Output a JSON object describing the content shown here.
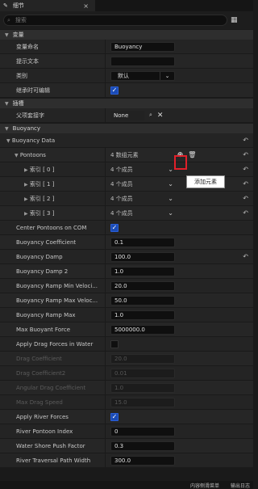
{
  "tab": {
    "title": "细节",
    "close": "×"
  },
  "search": {
    "placeholder": "搜索"
  },
  "sections": {
    "variable": "变量",
    "slot": "插槽",
    "buoyancy": "Buoyancy"
  },
  "variable": {
    "name_label": "变量命名",
    "name_value": "Buoyancy",
    "tooltip_label": "提示文本",
    "tooltip_value": "",
    "category_label": "类别",
    "category_value": "默认",
    "editable_label": "继承时可编辑"
  },
  "slot": {
    "parent_label": "父项套接字",
    "parent_value": "None"
  },
  "buoyancy": {
    "data_label": "Buoyancy Data",
    "pontoons_label": "Pontoons",
    "pontoons_value": "4 数组元素",
    "tooltip": "添加元素",
    "indices": [
      {
        "label": "索引 [ 0 ]",
        "value": "4 个成员"
      },
      {
        "label": "索引 [ 1 ]",
        "value": "4 个成员"
      },
      {
        "label": "索引 [ 2 ]",
        "value": "4 个成员"
      },
      {
        "label": "索引 [ 3 ]",
        "value": "4 个成员"
      }
    ],
    "props": [
      {
        "label": "Center Pontoons on COM",
        "type": "check",
        "checked": true
      },
      {
        "label": "Buoyancy Coefficient",
        "value": "0.1"
      },
      {
        "label": "Buoyancy Damp",
        "value": "100.0"
      },
      {
        "label": "Buoyancy Damp 2",
        "value": "1.0"
      },
      {
        "label": "Buoyancy Ramp Min Veloci...",
        "value": "20.0"
      },
      {
        "label": "Buoyancy Ramp Max Veloc...",
        "value": "50.0"
      },
      {
        "label": "Buoyancy Ramp Max",
        "value": "1.0"
      },
      {
        "label": "Max Buoyant Force",
        "value": "5000000.0"
      },
      {
        "label": "Apply Drag Forces in Water",
        "type": "check",
        "checked": false
      },
      {
        "label": "Drag Coefficient",
        "value": "20.0"
      },
      {
        "label": "Drag Coefficient2",
        "value": "0.01"
      },
      {
        "label": "Angular Drag Coefficient",
        "value": "1.0"
      },
      {
        "label": "Max Drag Speed",
        "value": "15.0"
      },
      {
        "label": "Apply River Forces",
        "type": "check",
        "checked": true
      },
      {
        "label": "River Pontoon Index",
        "value": "0"
      },
      {
        "label": "Water Shore Push Factor",
        "value": "0.3"
      },
      {
        "label": "River Traversal Path Width",
        "value": "300.0"
      }
    ]
  },
  "bottom": {
    "content_drawer": "内容侧滑菜单",
    "output_log": "输出日志"
  },
  "colors": {
    "accent": "#1a4bb5",
    "highlight": "#e0202a"
  }
}
